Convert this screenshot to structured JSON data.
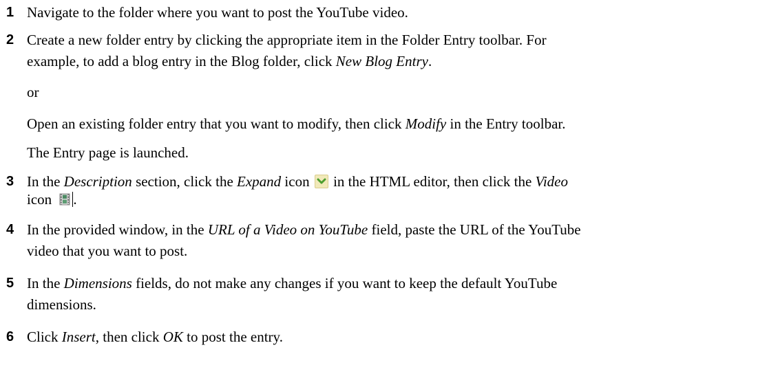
{
  "steps": [
    {
      "num": "1",
      "text": "Navigate to the folder where you want to post the YouTube video."
    },
    {
      "num": "2",
      "line1": "Create a new folder entry by clicking the appropriate item in the Folder Entry toolbar. For",
      "line2_a": "example, to add a blog entry in the Blog folder, click ",
      "line2_em": "New Blog Entry",
      "line2_b": ".",
      "or": "or",
      "alt_a": "Open an existing folder entry that you want to modify, then click ",
      "alt_em": "Modify",
      "alt_b": " in the Entry toolbar.",
      "result": "The Entry page is launched."
    },
    {
      "num": "3",
      "a": "In the ",
      "em1": "Description",
      "b": " section, click the ",
      "em2": "Expand",
      "c": " icon ",
      "d": " in the HTML editor, then click the ",
      "em3": "Video",
      "e": "icon ",
      "f": "."
    },
    {
      "num": "4",
      "a": "In the provided window, in the ",
      "em1": "URL of a Video on YouTube",
      "b": " field, paste the URL of the YouTube",
      "line2": "video that you want to post."
    },
    {
      "num": "5",
      "a": "In the ",
      "em1": "Dimensions",
      "b": " fields, do not make any changes if you want to keep the default YouTube",
      "line2": "dimensions."
    },
    {
      "num": "6",
      "a": "Click ",
      "em1": "Insert",
      "b": ", then click ",
      "em2": "OK",
      "c": " to post the entry."
    }
  ],
  "icons": {
    "expand": "chevron-down-icon",
    "video": "film-strip-icon",
    "expand_color": "#f1e9b9",
    "video_color": "#4d8a63"
  }
}
